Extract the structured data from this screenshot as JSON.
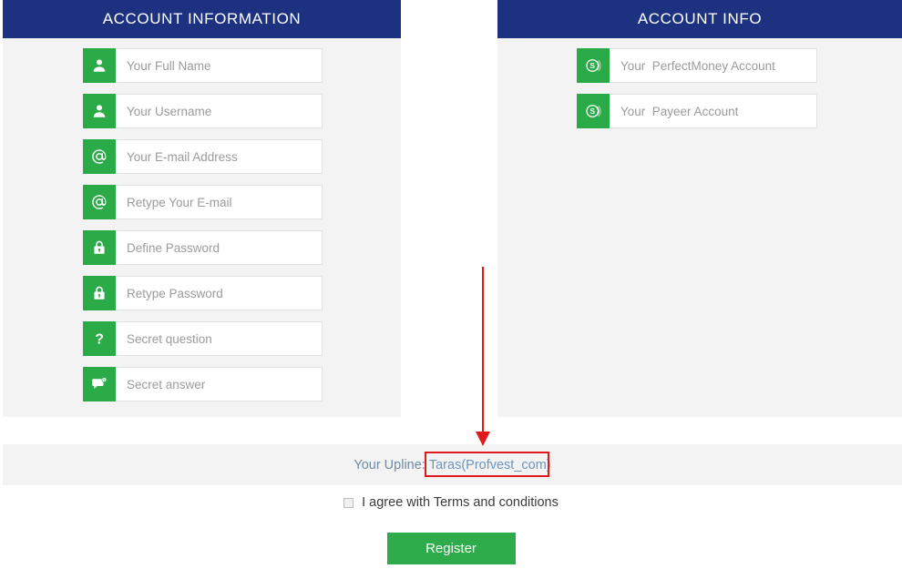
{
  "theme": {
    "header_blue": "#1c3281",
    "icon_green": "#2bab48",
    "button_green": "#2eab4b",
    "panel_bg": "#f3f3f3",
    "annotation_red": "#e01b1b",
    "upline_blue": "#6d95bd"
  },
  "left_panel": {
    "title": "ACCOUNT INFORMATION",
    "fields": [
      {
        "icon": "user-icon",
        "placeholder": "Your Full Name"
      },
      {
        "icon": "user-icon",
        "placeholder": "Your Username"
      },
      {
        "icon": "at-sign-icon",
        "placeholder": "Your E-mail Address"
      },
      {
        "icon": "at-sign-icon",
        "placeholder": "Retype Your E-mail"
      },
      {
        "icon": "lock-icon",
        "placeholder": "Define Password"
      },
      {
        "icon": "lock-icon",
        "placeholder": "Retype Password"
      },
      {
        "icon": "question-mark-icon",
        "placeholder": "Secret question"
      },
      {
        "icon": "speech-bubble-icon",
        "placeholder": "Secret answer"
      }
    ]
  },
  "right_panel": {
    "title": "ACCOUNT INFO",
    "fields": [
      {
        "icon": "dollar-coin-icon",
        "placeholder": "Your  PerfectMoney Account"
      },
      {
        "icon": "dollar-coin-icon",
        "placeholder": "Your  Payeer Account"
      }
    ]
  },
  "upline": {
    "label": "Your Upline: ",
    "value": "Taras(Profvest_com)"
  },
  "terms": {
    "label": "I agree with Terms and conditions",
    "checked": false
  },
  "submit": {
    "label": "Register"
  }
}
